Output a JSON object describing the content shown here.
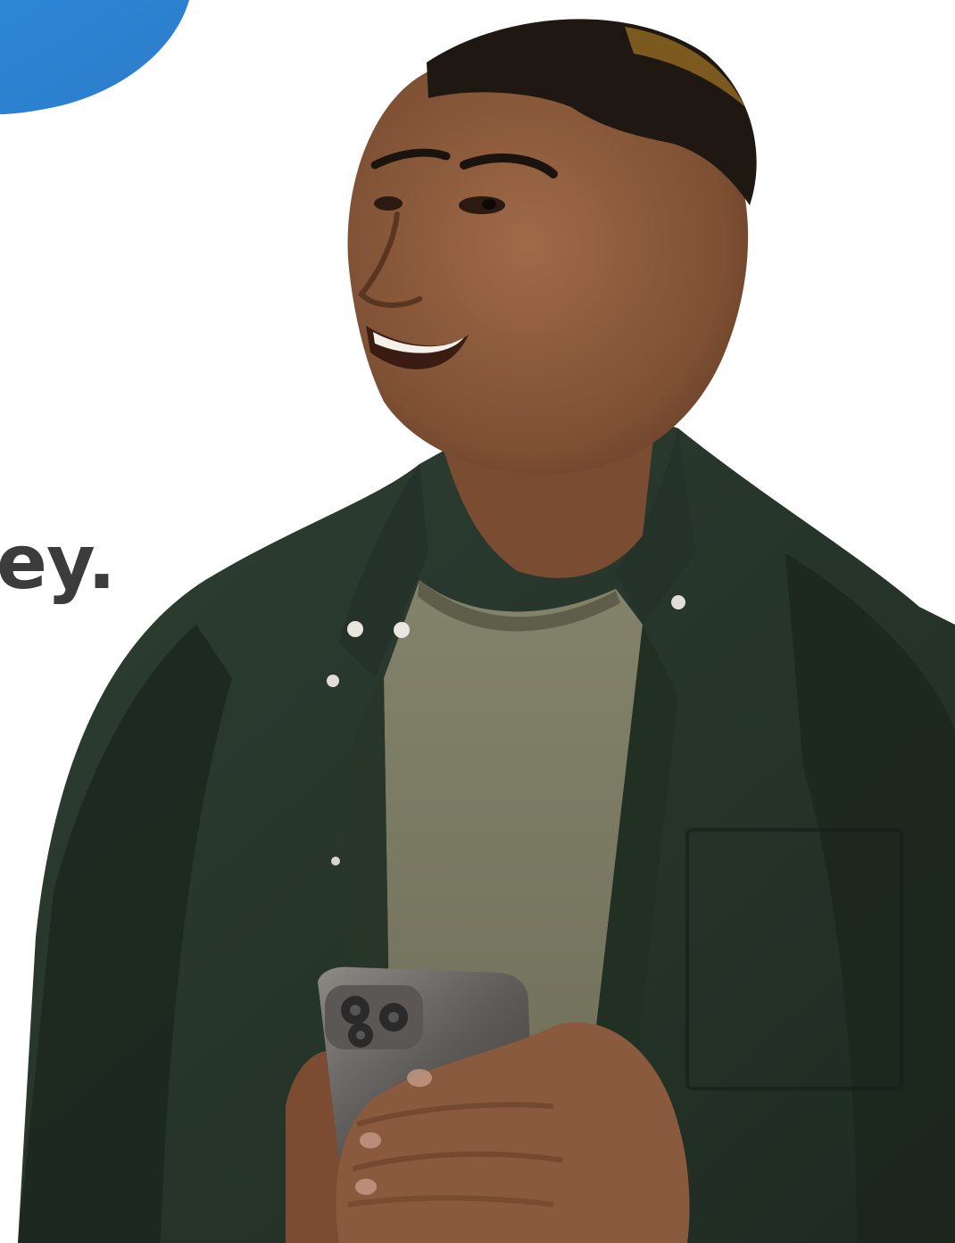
{
  "hero": {
    "headline_fragment": "ey."
  },
  "colors": {
    "accent_blue": "#2f86d6",
    "headline_text": "#3c3c3c",
    "shirt_green": "#26352b",
    "tshirt_olive": "#7a7a62",
    "skin": "#8a5a3e",
    "hair": "#1e1712",
    "phone": "#6d6a67",
    "background": "#ffffff"
  }
}
